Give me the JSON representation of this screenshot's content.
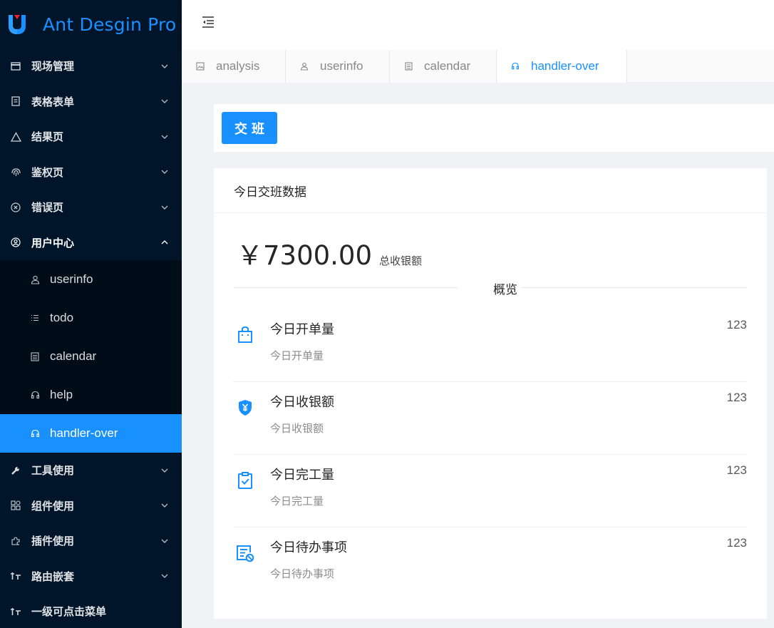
{
  "app": {
    "title": "Ant Desgin Pro"
  },
  "colors": {
    "sidebar": "#001529",
    "submenu": "#000c17",
    "primary": "#1890ff"
  },
  "sidebar": {
    "items": [
      {
        "label": "现场管理",
        "icon": "table-icon"
      },
      {
        "label": "表格表单",
        "icon": "form-icon"
      },
      {
        "label": "结果页",
        "icon": "warning-icon"
      },
      {
        "label": "鉴权页",
        "icon": "fingerprint-icon"
      },
      {
        "label": "错误页",
        "icon": "close-circle-icon"
      },
      {
        "label": "用户中心",
        "icon": "user-circle-icon",
        "open": true
      },
      {
        "label": "工具使用",
        "icon": "tool-icon"
      },
      {
        "label": "组件使用",
        "icon": "appstore-icon"
      },
      {
        "label": "插件使用",
        "icon": "puzzle-icon"
      },
      {
        "label": "路由嵌套",
        "icon": "nested-icon"
      },
      {
        "label": "一级可点击菜单",
        "icon": "nested-icon"
      }
    ],
    "subitems": [
      {
        "label": "userinfo",
        "icon": "user-icon"
      },
      {
        "label": "todo",
        "icon": "list-icon"
      },
      {
        "label": "calendar",
        "icon": "calendar-icon"
      },
      {
        "label": "help",
        "icon": "headset-icon"
      },
      {
        "label": "handler-over",
        "icon": "headset-icon",
        "active": true
      }
    ]
  },
  "tabs": [
    {
      "label": "analysis",
      "icon": "image-icon"
    },
    {
      "label": "userinfo",
      "icon": "user-icon"
    },
    {
      "label": "calendar",
      "icon": "calendar-icon"
    },
    {
      "label": "handler-over",
      "icon": "headset-icon",
      "active": true
    }
  ],
  "toolbar": {
    "handover_label": "交班"
  },
  "card": {
    "title": "今日交班数据",
    "amount": "￥7300.00",
    "amount_label": "总收银额",
    "divider_text": "概览",
    "items": [
      {
        "title": "今日开单量",
        "desc": "今日开单量",
        "value": "123",
        "icon": "shopping-bag-icon"
      },
      {
        "title": "今日收银额",
        "desc": "今日收银额",
        "value": "123",
        "icon": "money-shield-icon"
      },
      {
        "title": "今日完工量",
        "desc": "今日完工量",
        "value": "123",
        "icon": "clipboard-check-icon"
      },
      {
        "title": "今日待办事项",
        "desc": "今日待办事项",
        "value": "123",
        "icon": "todo-list-icon"
      }
    ]
  }
}
